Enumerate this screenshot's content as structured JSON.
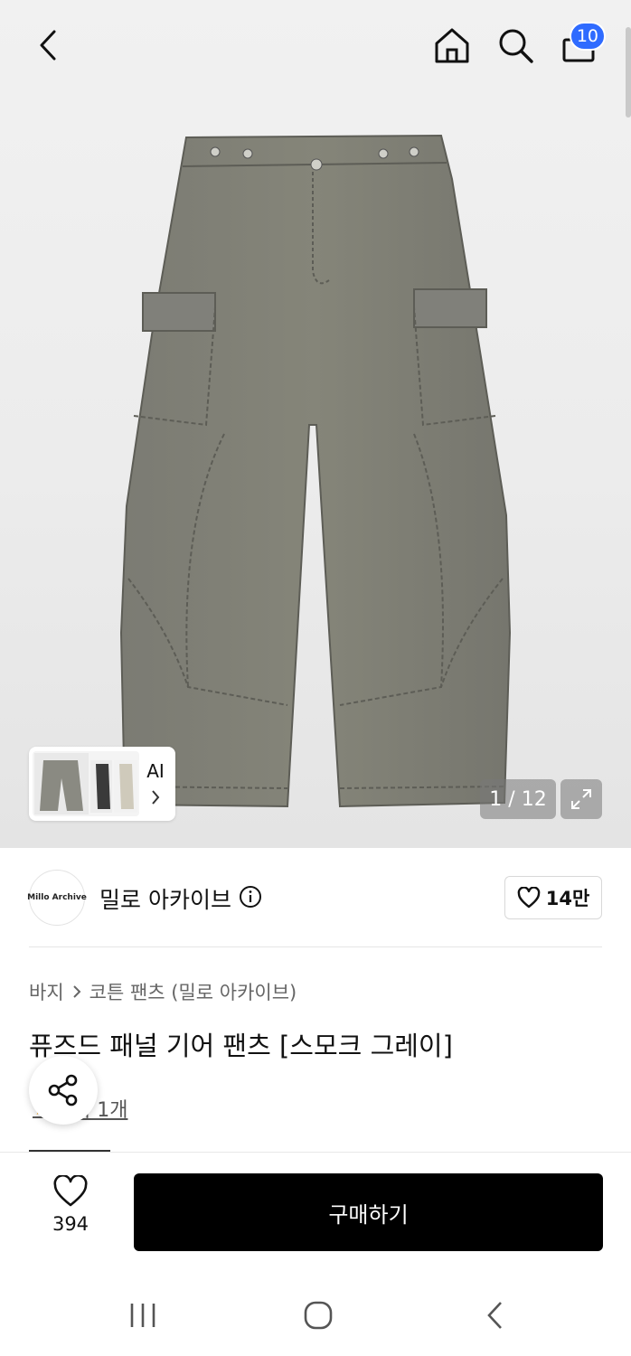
{
  "header": {
    "cart_count": "10"
  },
  "gallery": {
    "counter": "1 / 12",
    "ai_label": "AI"
  },
  "brand": {
    "logo_text": "Millo Archive",
    "name": "밀로 아카이브",
    "likes": "14만"
  },
  "breadcrumb": {
    "category": "바지",
    "subcategory": "코튼 팬츠 (밀로 아카이브)"
  },
  "product": {
    "title": "퓨즈드 패널 기어 팬츠 [스모크 그레이]",
    "review_text": "후기 1개"
  },
  "bottom_bar": {
    "wish_count": "394",
    "buy_label": "구매하기"
  },
  "colors": {
    "badge": "#2f6bff",
    "buy_button": "#000000",
    "pants": "#7a7a72"
  }
}
